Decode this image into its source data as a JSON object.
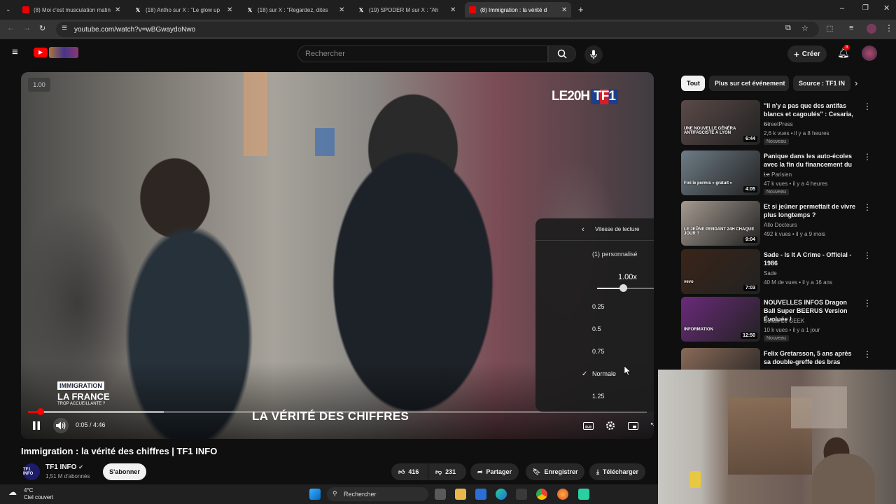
{
  "browser": {
    "tabs": [
      {
        "title": "(8) Moi c'est musculation matin",
        "icon": "youtube-icon",
        "active": false
      },
      {
        "title": "(18) Antho sur X : \"Le glow up",
        "icon": "x-icon",
        "active": false
      },
      {
        "title": "(18) sur X : \"Regardez, dites",
        "icon": "x-icon",
        "active": false
      },
      {
        "title": "(19) SPODER M sur X : \"Ah",
        "icon": "x-icon",
        "active": false
      },
      {
        "title": "(8) Immigration : la vérité d",
        "icon": "youtube-icon",
        "active": true
      }
    ],
    "new_tab": "+",
    "url": "youtube.com/watch?v=wBGwaydoNwo"
  },
  "header": {
    "search_placeholder": "Rechercher",
    "create_label": "Créer",
    "notification_count": "8"
  },
  "player": {
    "rate_badge": "1.00",
    "logo_text": "LE20H",
    "logo_box": "TF1",
    "overlay_tag": "IMMIGRATION",
    "overlay_title": "LA FRANCE",
    "overlay_sub": "TROP ACCUEILLANTE ?",
    "subtitle": "LA VÉRITÉ DES CHIFFRES",
    "time": "0:05 / 4:46",
    "progress": 0.017,
    "buffered": 0.22
  },
  "speed_menu": {
    "title": "Vitesse de lecture",
    "custom_label": "(1) personnalisé",
    "custom_value": "1.00x",
    "custom_slider_position": 0.43,
    "options": [
      {
        "label": "0.25",
        "selected": false
      },
      {
        "label": "0.5",
        "selected": false
      },
      {
        "label": "0.75",
        "selected": false
      },
      {
        "label": "Normale",
        "selected": true
      },
      {
        "label": "1.25",
        "selected": false
      }
    ]
  },
  "video": {
    "title": "Immigration : la vérité des chiffres | TF1 INFO",
    "channel": "TF1 INFO",
    "subscribers": "1,51 M d'abonnés",
    "subscribe_label": "S'abonner",
    "avatar_text": "TF1 INFO",
    "likes": "416",
    "dislikes": "231",
    "share_label": "Partager",
    "save_label": "Enregistrer",
    "download_label": "Télécharger"
  },
  "chips": [
    {
      "label": "Tout",
      "selected": true
    },
    {
      "label": "Plus sur cet événement",
      "selected": false
    },
    {
      "label": "Source : TF1 IN",
      "selected": false
    }
  ],
  "recommendations": [
    {
      "title": "\"Il n'y a pas que des antifas blancs et cagoulés\" : Cesaria, ...",
      "channel": "StreetPress",
      "meta": "2,6 k vues • il y a 8 heures",
      "badge": "Nouveau",
      "duration": "6:44",
      "thumb_text": "UNE NOUVELLE GÉNÉRA ANTIFASCISTE À LYON",
      "thumb_color": "#5a4a48"
    },
    {
      "title": "Panique dans les auto-écoles avec la fin du financement du ...",
      "channel": "Le Parisien",
      "meta": "47 k vues • il y a 4 heures",
      "badge": "Nouveau",
      "duration": "4:05",
      "thumb_text": "Fini le permis « gratuit »",
      "thumb_color": "#6e7c86"
    },
    {
      "title": "Et si jeûner permettait de vivre plus longtemps ?",
      "channel": "Allo Docteurs",
      "meta": "492 k vues • il y a 9 mois",
      "badge": "",
      "duration": "9:04",
      "thumb_text": "LE JEÛNE PENDANT 24H CHAQUE JOUR ?",
      "thumb_color": "#a49a90"
    },
    {
      "title": "Sade - Is It A Crime - Official - 1986",
      "channel": "Sade",
      "meta": "40 M de vues • il y a 16 ans",
      "badge": "",
      "duration": "7:03",
      "thumb_text": "vevo",
      "thumb_color": "#3a2418"
    },
    {
      "title": "NOUVELLES INFOS Dragon Ball Super BEERUS Version Évoluée !",
      "channel": "Sofian Le GEEK",
      "meta": "10 k vues • il y a 1 jour",
      "badge": "Nouveau",
      "duration": "12:50",
      "thumb_text": "INFORMATION",
      "thumb_color": "#6a2a7a"
    },
    {
      "title": "Felix Gretarsson, 5 ans après sa double-greffe des bras",
      "channel": "",
      "meta": "",
      "badge": "",
      "duration": "",
      "thumb_text": "",
      "thumb_color": "#8a6a58"
    }
  ],
  "taskbar": {
    "temperature": "4°C",
    "weather": "Ciel couvert",
    "search_label": "Rechercher"
  }
}
